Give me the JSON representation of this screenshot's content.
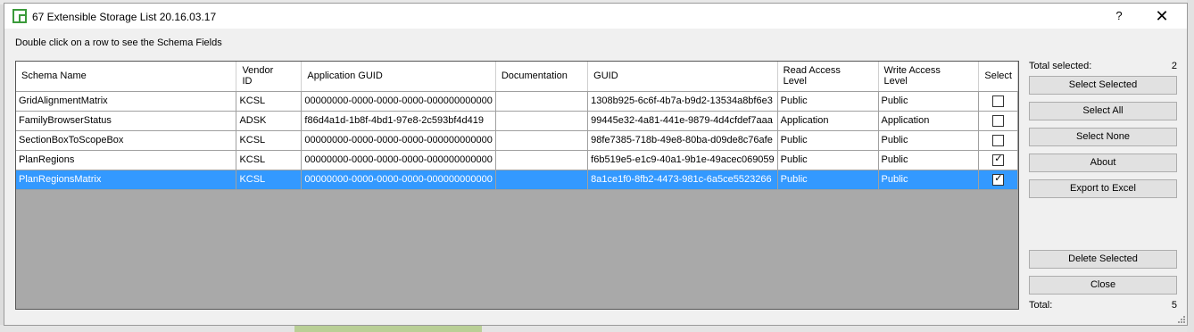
{
  "window": {
    "title": "67 Extensible Storage List 20.16.03.17",
    "help_label": "?",
    "close_label": "✕",
    "instruction": "Double click on a row to see the Schema Fields"
  },
  "grid": {
    "columns": [
      {
        "label": "Schema Name"
      },
      {
        "label": "Vendor\nID"
      },
      {
        "label": "Application GUID"
      },
      {
        "label": "Documentation"
      },
      {
        "label": "GUID"
      },
      {
        "label": "Read Access\nLevel"
      },
      {
        "label": "Write Access\nLevel"
      },
      {
        "label": "Select"
      }
    ],
    "rows": [
      {
        "schema_name": "GridAlignmentMatrix",
        "vendor_id": "KCSL",
        "application_guid": "00000000-0000-0000-0000-000000000000",
        "documentation": "",
        "guid": "1308b925-6c6f-4b7a-b9d2-13534a8bf6e3",
        "read_access": "Public",
        "write_access": "Public",
        "selected": false
      },
      {
        "schema_name": "FamilyBrowserStatus",
        "vendor_id": "ADSK",
        "application_guid": "f86d4a1d-1b8f-4bd1-97e8-2c593bf4d419",
        "documentation": "",
        "guid": "99445e32-4a81-441e-9879-4d4cfdef7aaa",
        "read_access": "Application",
        "write_access": "Application",
        "selected": false
      },
      {
        "schema_name": "SectionBoxToScopeBox",
        "vendor_id": "KCSL",
        "application_guid": "00000000-0000-0000-0000-000000000000",
        "documentation": "",
        "guid": "98fe7385-718b-49e8-80ba-d09de8c76afe",
        "read_access": "Public",
        "write_access": "Public",
        "selected": false
      },
      {
        "schema_name": "PlanRegions",
        "vendor_id": "KCSL",
        "application_guid": "00000000-0000-0000-0000-000000000000",
        "documentation": "",
        "guid": "f6b519e5-e1c9-40a1-9b1e-49acec069059",
        "read_access": "Public",
        "write_access": "Public",
        "selected": true
      },
      {
        "schema_name": "PlanRegionsMatrix",
        "vendor_id": "KCSL",
        "application_guid": "00000000-0000-0000-0000-000000000000",
        "documentation": "",
        "guid": "8a1ce1f0-8fb2-4473-981c-6a5ce5523266",
        "read_access": "Public",
        "write_access": "Public",
        "selected": true
      }
    ],
    "highlighted_row": 4
  },
  "side": {
    "total_selected_label": "Total selected:",
    "total_selected_value": "2",
    "select_selected": "Select Selected",
    "select_all": "Select All",
    "select_none": "Select None",
    "about": "About",
    "export_excel": "Export to Excel",
    "delete_selected": "Delete Selected",
    "close": "Close",
    "total_label": "Total:",
    "total_value": "5"
  },
  "colors": {
    "selection": "#3399ff",
    "app_icon": "#3a9a3a"
  }
}
